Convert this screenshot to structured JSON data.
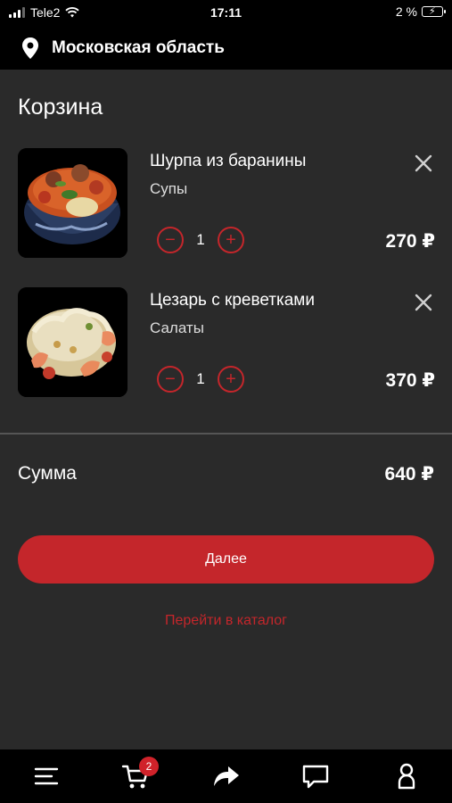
{
  "status": {
    "carrier": "Tele2",
    "time": "17:11",
    "battery": "2 %"
  },
  "location": {
    "label": "Московская область",
    "icon": "location-pin-icon"
  },
  "cart": {
    "title": "Корзина",
    "items": [
      {
        "name": "Шурпа из баранины",
        "category": "Супы",
        "quantity": "1",
        "price": "270 ₽",
        "image": "shurpa-soup-image"
      },
      {
        "name": "Цезарь с креветками",
        "category": "Салаты",
        "quantity": "1",
        "price": "370 ₽",
        "image": "caesar-salad-image"
      }
    ],
    "sum_label": "Сумма",
    "sum_value": "640 ₽",
    "next_label": "Далее",
    "catalog_link": "Перейти в каталог"
  },
  "tabbar": {
    "items": [
      {
        "icon": "menu-icon"
      },
      {
        "icon": "cart-icon",
        "badge": "2"
      },
      {
        "icon": "share-arrow-icon"
      },
      {
        "icon": "chat-icon"
      },
      {
        "icon": "profile-icon"
      }
    ]
  },
  "colors": {
    "accent": "#c4262b",
    "background": "#2a2a2a",
    "bar": "#000000"
  }
}
